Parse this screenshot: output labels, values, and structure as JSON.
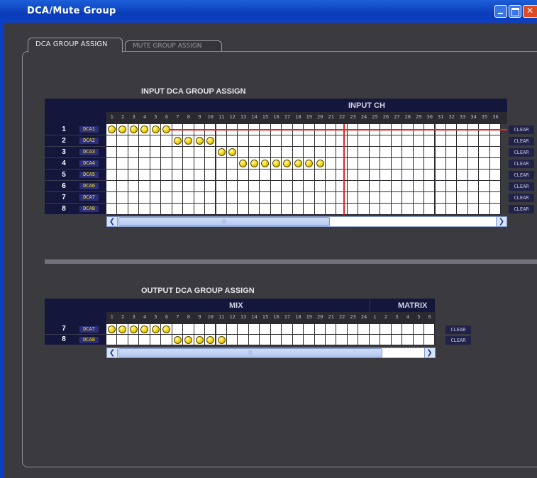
{
  "window": {
    "title": "DCA/Mute Group"
  },
  "tabs": [
    {
      "label": "DCA GROUP ASSIGN",
      "active": true
    },
    {
      "label": "MUTE GROUP ASSIGN",
      "active": false
    }
  ],
  "input_section": {
    "title": "INPUT DCA GROUP ASSIGN",
    "header": "INPUT CH",
    "visible_channels": [
      "1",
      "2",
      "3",
      "4",
      "5",
      "6",
      "7",
      "8",
      "9",
      "10",
      "11",
      "12",
      "13",
      "14",
      "15",
      "16",
      "17",
      "18",
      "19",
      "20",
      "21",
      "22",
      "23",
      "24",
      "25",
      "26",
      "27",
      "28",
      "29",
      "30",
      "31",
      "32",
      "33",
      "34",
      "35",
      "36"
    ],
    "rows": [
      {
        "num": "1",
        "label": "DCA1",
        "assigned": [
          1,
          2,
          3,
          4,
          5,
          6
        ]
      },
      {
        "num": "2",
        "label": "DCA2",
        "assigned": [
          7,
          8,
          9,
          10
        ]
      },
      {
        "num": "3",
        "label": "DCA3",
        "assigned": [
          11,
          12
        ]
      },
      {
        "num": "4",
        "label": "DCA4",
        "assigned": [
          13,
          14,
          15,
          16,
          17,
          18,
          19,
          20
        ]
      },
      {
        "num": "5",
        "label": "DCA5",
        "assigned": []
      },
      {
        "num": "6",
        "label": "DCA6",
        "assigned": []
      },
      {
        "num": "7",
        "label": "DCA7",
        "assigned": []
      },
      {
        "num": "8",
        "label": "DCA8",
        "assigned": []
      }
    ],
    "cursor": {
      "row": 1,
      "column": 22
    },
    "clear_label": "CLEAR"
  },
  "output_section": {
    "title": "OUTPUT DCA GROUP ASSIGN",
    "mix_header": "MIX",
    "matrix_header": "MATRIX",
    "mix_channels": [
      "1",
      "2",
      "3",
      "4",
      "5",
      "6",
      "7",
      "8",
      "9",
      "10",
      "11",
      "12",
      "13",
      "14",
      "15",
      "16",
      "17",
      "18",
      "19",
      "20",
      "21",
      "22",
      "23",
      "24"
    ],
    "matrix_channels": [
      "1",
      "2",
      "3",
      "4",
      "5",
      "6"
    ],
    "rows": [
      {
        "num": "7",
        "label": "DCA7",
        "assigned": [
          1,
          2,
          3,
          4,
          5,
          6
        ]
      },
      {
        "num": "8",
        "label": "DCA8",
        "assigned": [
          7,
          8,
          9,
          10,
          11
        ]
      }
    ],
    "clear_label": "CLEAR"
  },
  "colors": {
    "dot": "#f3d200",
    "label_text": "#f3e400",
    "header_bg": "#14163c",
    "cursor": "#e22424"
  }
}
